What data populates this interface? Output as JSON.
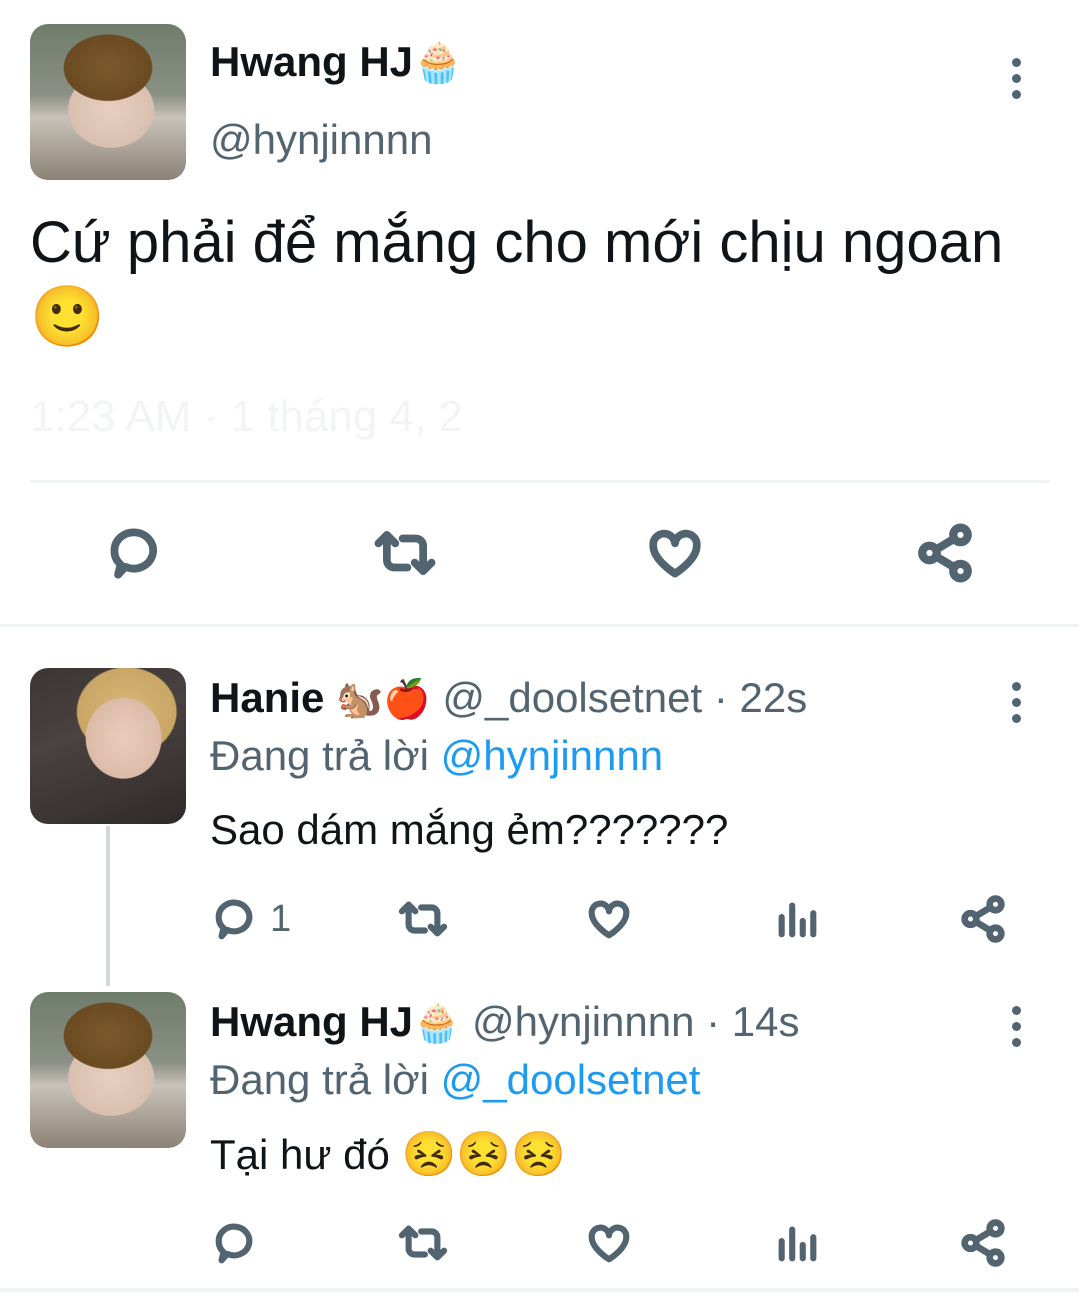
{
  "main_tweet": {
    "display_name": "Hwang HJ",
    "name_emoji": "🧁",
    "handle": "@hynjinnnn",
    "text": "Cứ phải để mắng cho mới chịu ngoan",
    "text_emoji": "🙂",
    "faded_meta": "1:23 AM · 1 tháng 4, 2",
    "icons": [
      "reply-icon",
      "retweet-icon",
      "like-icon",
      "share-icon"
    ]
  },
  "replies": [
    {
      "display_name": "Hanie",
      "name_emoji": "🐿️🍎",
      "handle": "@_doolsetnet",
      "time": "· 22s",
      "replying_prefix": "Đang trả lời",
      "replying_to": "@hynjinnnn",
      "text": "Sao dám mắng ẻm???????",
      "reply_count": "1"
    },
    {
      "display_name": "Hwang HJ",
      "name_emoji": "🧁",
      "handle": "@hynjinnnn",
      "time": "· 14s",
      "replying_prefix": "Đang trả lời",
      "replying_to": "@_doolsetnet",
      "text": "Tại hư đó",
      "text_emoji": "😣😣😣",
      "reply_count": ""
    }
  ],
  "colors": {
    "text_primary": "#0f1419",
    "text_secondary": "#536471",
    "link": "#1d9bf0",
    "divider": "#eff3f4"
  }
}
